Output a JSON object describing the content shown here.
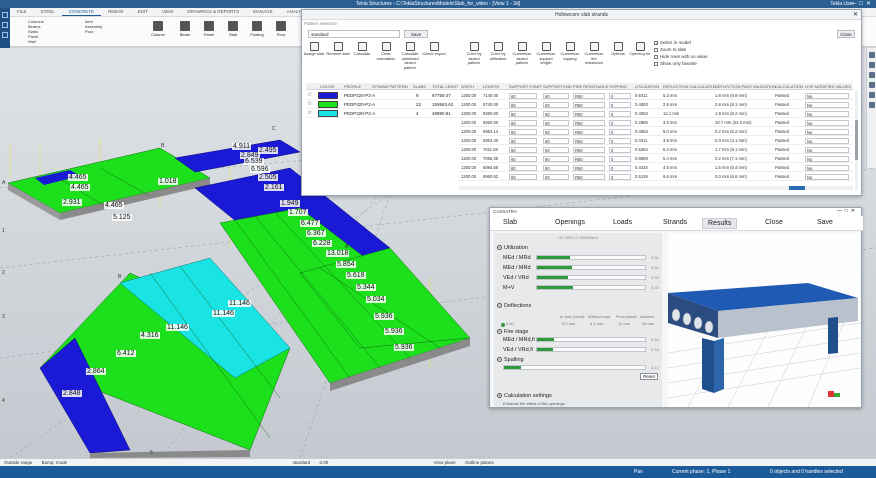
{
  "window": {
    "title": "Tekla Structures - C:\\TeklaStructuresModels\\Slab_for_video - [View 1 - 3d]",
    "user": "Tekla User"
  },
  "ribbon": {
    "tabs": [
      "FILE",
      "STEEL",
      "CONCRETE",
      "REBAR",
      "EDIT",
      "VIEW",
      "DRAWINGS & REPORTS",
      "MANAGE",
      "ANALYSIS & DESIGN",
      "TRIMBLE CONNECT"
    ],
    "small_items": [
      "Columns",
      "Beams",
      "Slabs",
      "Panel",
      "Wall",
      "Item",
      "Assembly",
      "Pour",
      "Item"
    ],
    "buttons": [
      "Column",
      "Beam",
      "Panel",
      "Slab",
      "Footing",
      "Pour",
      "Cast unit"
    ]
  },
  "slab_strands": {
    "title": "Hollowcore slab strands",
    "subtitle": "Pattern selection",
    "preset": "standard",
    "save_label": "Save",
    "close_label": "Close",
    "toolbar": [
      "Assign slab",
      "Remove slab",
      "Calculate",
      "Clear calculation",
      "Calculate optimized strand pattern",
      "Check export",
      "Color by strand pattern",
      "Color by utilization",
      "Customize strand pattern",
      "Customize support length",
      "Customize topping",
      "Customize fire resistance",
      "Options",
      "Opening for"
    ],
    "checks": [
      {
        "label": "Select in model",
        "checked": true
      },
      {
        "label": "Zoom to slab",
        "checked": false
      },
      {
        "label": "Hide rows with no value",
        "checked": false
      },
      {
        "label": "Show only favorite",
        "checked": false
      }
    ],
    "left_headers": [
      "COLOR",
      "PROFILE",
      "STRAND PATTERN",
      "SLABS",
      "TOTAL LENGTH"
    ],
    "patterns": [
      {
        "color": "#1a1ad6",
        "profile": "PEDP320-P2-A",
        "slabs": "9",
        "length": "67759.47"
      },
      {
        "color": "#1ce01c",
        "profile": "PEDP320-P2-A",
        "slabs": "22",
        "length": "159563.62"
      },
      {
        "color": "#19e3e3",
        "profile": "PEDP320-P2-A",
        "slabs": "4",
        "length": "48990.81"
      }
    ],
    "right_headers": [
      "WIDTH",
      "LENGTH",
      "SUPPORT START",
      "SUPPORT END",
      "FIRE RESISTANCE",
      "TOPPING",
      "UTILIZATION",
      "DEFLECTION CALCULATED",
      "DEFLECTION PASS VALIDATION",
      "CALCULATION",
      "LIVE MODIFIED VALUES"
    ],
    "rows": [
      {
        "w": "1200.00",
        "l": "7140.00",
        "ss": "60",
        "se": "60",
        "fr": "R60",
        "tp": "0",
        "ut": "0.6411",
        "dc": "5.3 mm",
        "dv": "1.8 mm (9.9 mm)",
        "calc": "Passed",
        "lm": "No"
      },
      {
        "w": "1200.00",
        "l": "5740.00",
        "ss": "60",
        "se": "60",
        "fr": "R60",
        "tp": "0",
        "ut": "0.4083",
        "dc": "2.8 mm",
        "dv": "2.8 mm (8.1 mm)",
        "calc": "Passed",
        "lm": "No"
      },
      {
        "w": "1200.00",
        "l": "9260.00",
        "ss": "60",
        "se": "60",
        "fr": "R60",
        "tp": "0",
        "ut": "0.4053",
        "dc": "12.1 mm",
        "dv": "1.9 mm (8.2 mm)",
        "calc": "Passed",
        "lm": "No"
      },
      {
        "w": "1200.00",
        "l": "5560.00",
        "ss": "60",
        "se": "60",
        "fr": "R60",
        "tp": "0",
        "ut": "0.2865",
        "dc": "3.5 mm",
        "dv": "10.7 mm (22.3 mm)",
        "calc": "Passed",
        "lm": "No"
      },
      {
        "w": "1200.00",
        "l": "6953.14",
        "ss": "60",
        "se": "60",
        "fr": "R60",
        "tp": "0",
        "ut": "0.4553",
        "dc": "5.0 mm",
        "dv": "0.2 mm (5.2 mm)",
        "calc": "Passed",
        "lm": "No"
      },
      {
        "w": "1200.00",
        "l": "5953.40",
        "ss": "60",
        "se": "60",
        "fr": "R60",
        "tp": "0",
        "ut": "0.4311",
        "dc": "3.9 mm",
        "dv": "0.3 mm (4.1 mm)",
        "calc": "Passed",
        "lm": "No"
      },
      {
        "w": "1200.00",
        "l": "7011.58",
        "ss": "60",
        "se": "60",
        "fr": "R60",
        "tp": "0",
        "ut": "0.5284",
        "dc": "6.4 mm",
        "dv": "1.7 mm (9.1 mm)",
        "calc": "Passed",
        "lm": "No"
      },
      {
        "w": "1200.00",
        "l": "7056.38",
        "ss": "60",
        "se": "60",
        "fr": "R60",
        "tp": "0",
        "ut": "0.6899",
        "dc": "5.4 mm",
        "dv": "0.2 mm (7.1 mm)",
        "calc": "Passed",
        "lm": "No"
      },
      {
        "w": "1200.00",
        "l": "6894.68",
        "ss": "60",
        "se": "60",
        "fr": "R60",
        "tp": "0",
        "ut": "0.4434",
        "dc": "4.6 mm",
        "dv": "1.5 mm (6.4 mm)",
        "calc": "Passed",
        "lm": "No"
      },
      {
        "w": "1200.00",
        "l": "6960.62",
        "ss": "60",
        "se": "60",
        "fr": "R60",
        "tp": "0",
        "ut": "0.5126",
        "dc": "6.6 mm",
        "dv": "0.0 mm (6.6 mm)",
        "calc": "Passed",
        "lm": "No"
      }
    ]
  },
  "slab_dialog": {
    "title": "CASSATRA",
    "tabs": [
      "Slab",
      "Openings",
      "Loads",
      "Strands",
      "Results",
      "Close",
      "Save"
    ],
    "selected_tab": "Results",
    "panel_header": "HC 320/1.2 4000kN/m",
    "utilization_label": "Utilization",
    "utilization": [
      {
        "label": "MEd / MRd",
        "value": 0.31,
        "text": "0.31"
      },
      {
        "label": "MEd / MRd",
        "value": 0.32,
        "text": "0.32"
      },
      {
        "label": "VEd / VRd",
        "value": 0.29,
        "text": "0.29"
      },
      {
        "label": "M+V",
        "value": 0.33,
        "text": "0.33"
      }
    ],
    "deflections_label": "Deflections",
    "deflection_cols": [
      "In slab (dead)",
      "Without load",
      "Final phase",
      "Allowed"
    ],
    "deflection_vals": [
      "5.0 mm",
      "6.1 mm",
      "11 mm",
      "34 mm"
    ],
    "deflection_row": "0.00",
    "fire_label": "Fire stage",
    "fire": [
      {
        "label": "MEd / MRd,fi",
        "value": 0.16,
        "text": "0.16"
      },
      {
        "label": "VEd / VRd,fi",
        "value": 0.15,
        "text": "0.15"
      }
    ],
    "spalling_label": "Spalling",
    "spalling": {
      "value": 0.12,
      "text": "0.12"
    },
    "reset_label": "Reset",
    "calc_label": "Calculation settings",
    "calc_sub": "Enhance the effect of the openings"
  },
  "labels3d": [
    "4.911",
    "2.849",
    "2.495",
    "6.539",
    "6.596",
    "2.505",
    "2.161",
    "1.949",
    "1.707",
    "6.477",
    "6.367",
    "6.228",
    "13.018",
    "5.854",
    "5.618",
    "5.344",
    "5.034",
    "5.936",
    "5.936",
    "5.936",
    "4.465",
    "4.465",
    "1.018",
    "2.931",
    "4.465",
    "5.125",
    "11.146",
    "11.146",
    "11.146",
    "4.316",
    "6.412",
    "2.864",
    "2.848"
  ],
  "axis_labels": [
    "B",
    "C",
    "D",
    "A",
    "1",
    "2",
    "3",
    "4",
    "5",
    "B",
    "A"
  ],
  "options_bar": [
    "Outside range",
    "Bump: mode",
    "standard",
    "0.00",
    "View plane",
    "Outline planes"
  ],
  "status": {
    "pan": "Pan",
    "phase": "Current phase: 1, Phase 1",
    "selection": "0 objects and 0 handles selected"
  },
  "colors": {
    "blue": "#1a1ad6",
    "green": "#1ce01c",
    "cyan": "#19e3e3",
    "status_blue": "#1c5b9a"
  }
}
